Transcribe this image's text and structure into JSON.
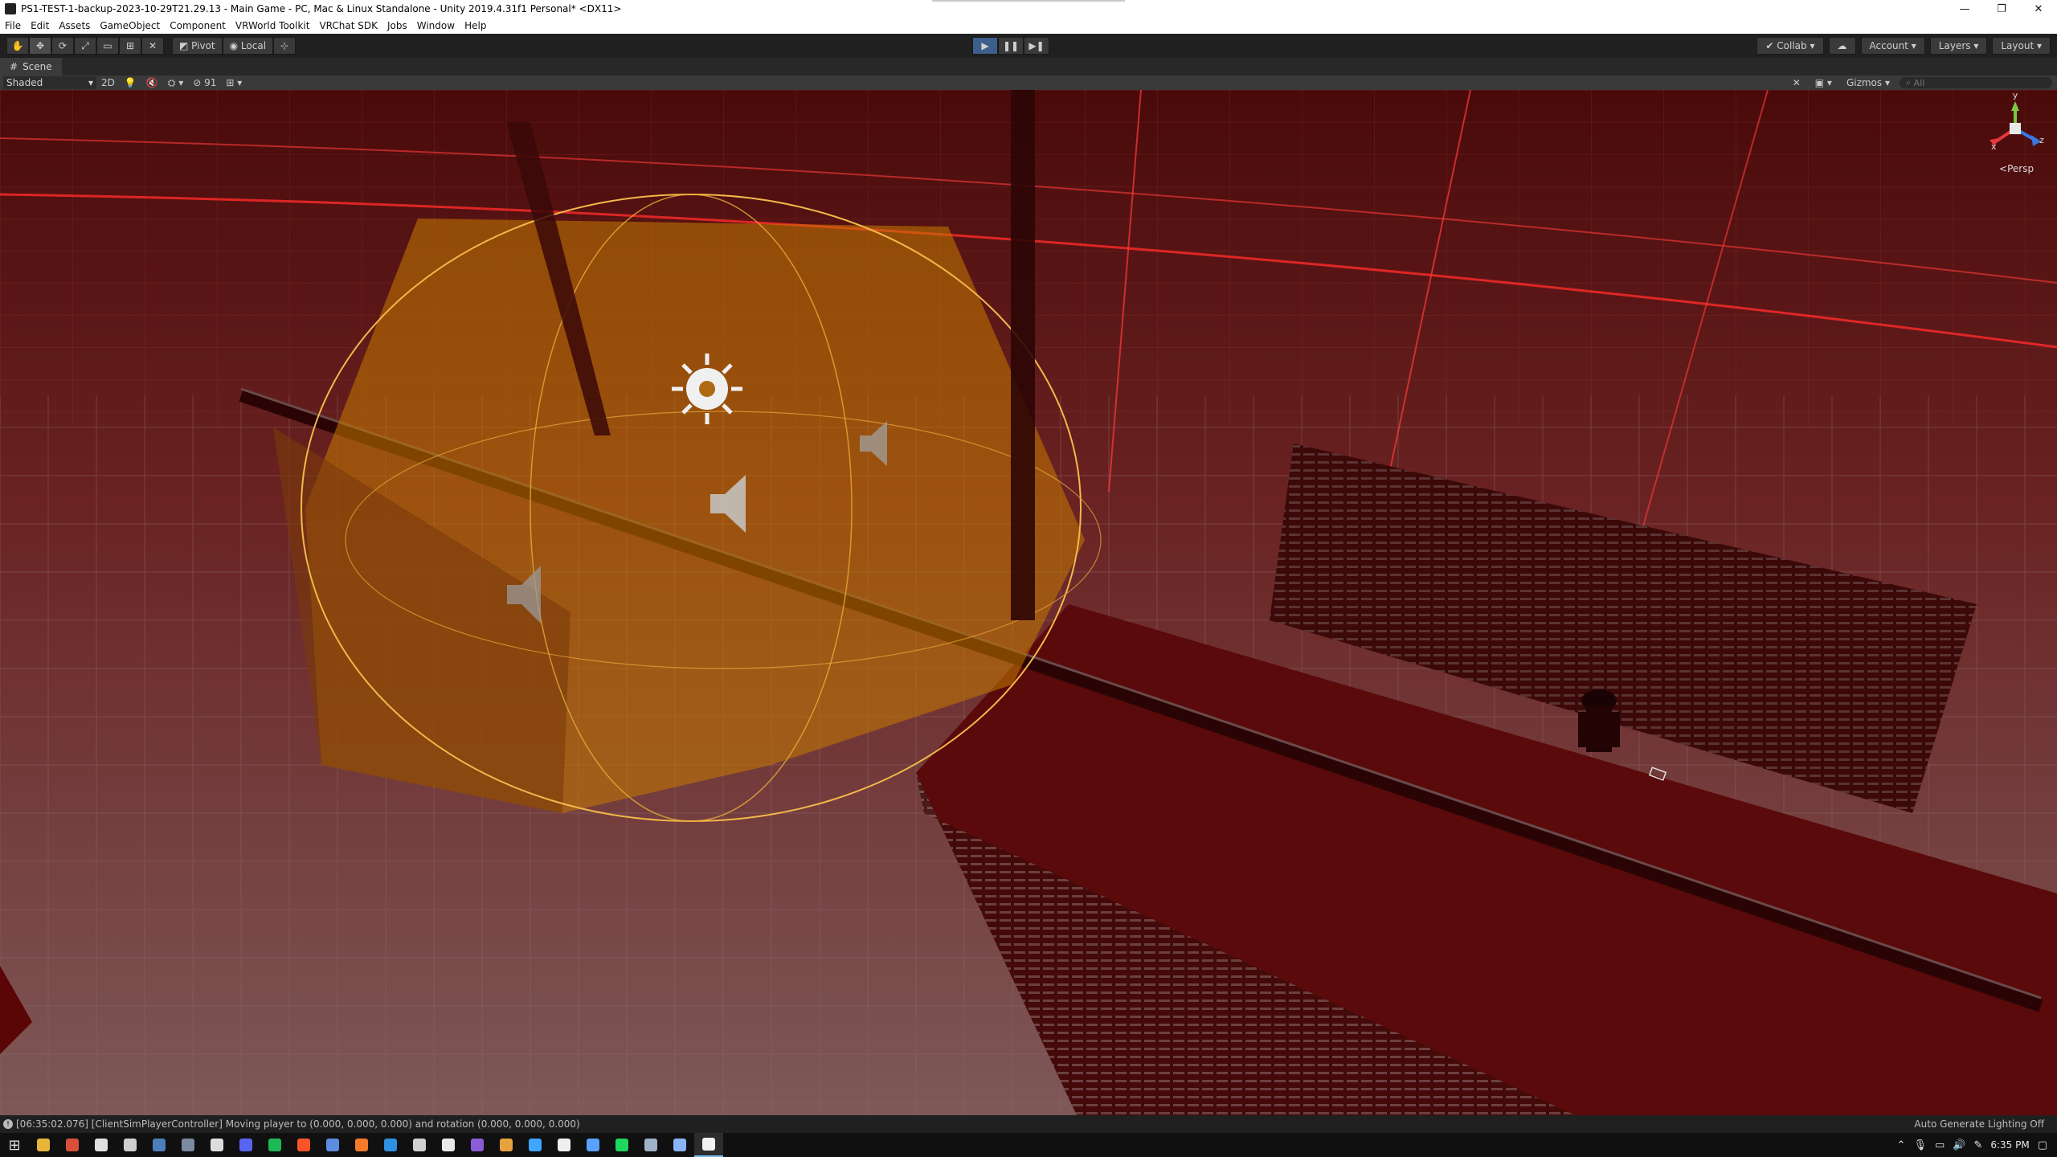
{
  "window": {
    "title": "PS1-TEST-1-backup-2023-10-29T21.29.13 - Main Game - PC, Mac & Linux Standalone - Unity 2019.4.31f1 Personal* <DX11>",
    "minimize_glyph": "—",
    "maximize_glyph": "❐",
    "close_glyph": "✕"
  },
  "menu": [
    "File",
    "Edit",
    "Assets",
    "GameObject",
    "Component",
    "VRWorld Toolkit",
    "VRChat SDK",
    "Jobs",
    "Window",
    "Help"
  ],
  "toolbar": {
    "tool_icons": [
      "hand-icon",
      "move-icon",
      "rotate-icon",
      "scale-icon",
      "rect-icon",
      "transform-icon",
      "custom-tool-icon"
    ],
    "pivot_label": "Pivot",
    "local_label": "Local",
    "play_glyph": "▶",
    "pause_glyph": "❚❚",
    "step_glyph": "▶❚",
    "collab_label": "Collab",
    "account_label": "Account",
    "layers_label": "Layers",
    "layout_label": "Layout"
  },
  "scene": {
    "tab_label": "Scene",
    "shading_mode": "Shaded",
    "mode_2d": "2D",
    "hidden_count": "91",
    "gizmos_label": "Gizmos",
    "search_placeholder": "All",
    "projection_label": "Persp",
    "axis_labels": {
      "x": "x",
      "y": "y",
      "z": "z"
    }
  },
  "status": {
    "message": "[06:35:02.076] [ClientSimPlayerController] Moving player to (0.000, 0.000, 0.000) and rotation (0.000, 0.000, 0.000)",
    "lighting": "Auto Generate Lighting Off"
  },
  "taskbar": {
    "clock": "6:35 PM",
    "apps": [
      {
        "name": "file-explorer-icon",
        "color": "#e8b53a"
      },
      {
        "name": "browser-icon",
        "color": "#d94f3a"
      },
      {
        "name": "epic-games-icon",
        "color": "#e0e0e0"
      },
      {
        "name": "terminal-icon",
        "color": "#cfcfcf"
      },
      {
        "name": "steam-icon",
        "color": "#4b7fb8"
      },
      {
        "name": "remote-desktop-icon",
        "color": "#7a8aa0"
      },
      {
        "name": "unity-hub-icon",
        "color": "#dddddd"
      },
      {
        "name": "discord-icon",
        "color": "#5865f2"
      },
      {
        "name": "spotify-icon",
        "color": "#1db954"
      },
      {
        "name": "brave-icon",
        "color": "#fb542b"
      },
      {
        "name": "git-icon",
        "color": "#5b8de0"
      },
      {
        "name": "blender-icon",
        "color": "#f5792a"
      },
      {
        "name": "vscode-icon",
        "color": "#2f8fe0"
      },
      {
        "name": "obs-icon",
        "color": "#d0d0d0"
      },
      {
        "name": "github-icon",
        "color": "#e8e8e8"
      },
      {
        "name": "vrchat-icon",
        "color": "#8c5bd6"
      },
      {
        "name": "notes-icon",
        "color": "#e6a23c"
      },
      {
        "name": "info-app-icon",
        "color": "#3ea6ff"
      },
      {
        "name": "notion-icon",
        "color": "#eeeeee"
      },
      {
        "name": "vpn-icon",
        "color": "#5aa2ff"
      },
      {
        "name": "spotify-alt-icon",
        "color": "#1ed760"
      },
      {
        "name": "package-icon",
        "color": "#9fb3c8"
      },
      {
        "name": "settings-app-icon",
        "color": "#8ab4f8"
      },
      {
        "name": "unity-editor-icon",
        "color": "#f2f2f2"
      }
    ]
  }
}
